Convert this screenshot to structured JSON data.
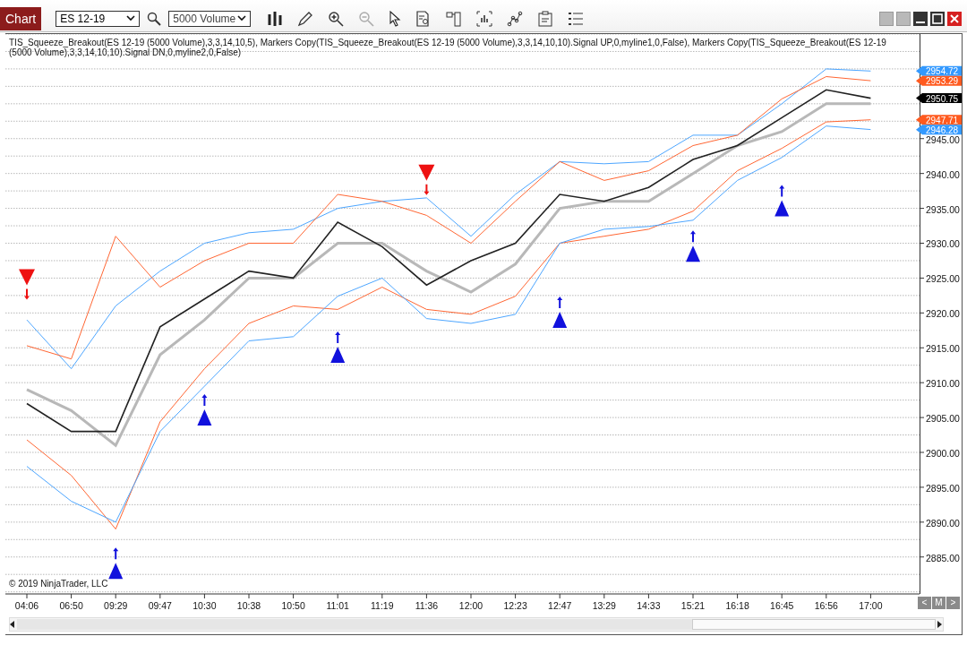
{
  "tab": "Chart",
  "instrument": {
    "value": "ES 12-19"
  },
  "interval": {
    "value": "5000 Volume"
  },
  "legend": "TIS_Squeeze_Breakout(ES 12-19 (5000 Volume),3,3,14,10,5), Markers Copy(TIS_Squeeze_Breakout(ES 12-19 (5000 Volume),3,3,14,10,10).Signal UP,0,myline1,0,False), Markers Copy(TIS_Squeeze_Breakout(ES 12-19 (5000 Volume),3,3,14,10,10).Signal DN,0,myline2,0,False)",
  "copyright": "© 2019 NinjaTrader, LLC",
  "nav_buttons": [
    "<",
    "M",
    ">"
  ],
  "price_tags": [
    {
      "label": "2954.72",
      "color": "#3399ff"
    },
    {
      "label": "2953.29",
      "color": "#ff5a1f"
    },
    {
      "label": "2950.75",
      "color": "#000000"
    },
    {
      "label": "2947.71",
      "color": "#ff5a1f"
    },
    {
      "label": "2946.28",
      "color": "#3399ff"
    }
  ],
  "chart_data": {
    "type": "line",
    "grid": true,
    "categories": [
      "04:06",
      "06:50",
      "09:29",
      "09:47",
      "10:30",
      "10:38",
      "10:50",
      "11:01",
      "11:19",
      "11:36",
      "12:00",
      "12:23",
      "12:47",
      "13:29",
      "14:33",
      "15:21",
      "16:18",
      "16:45",
      "16:56",
      "17:00"
    ],
    "series": [
      {
        "color": "#4da6ff",
        "values": [
          2919,
          2912,
          2921,
          2926,
          2930,
          2931.5,
          2932,
          2935,
          2936,
          2936.5,
          2931,
          2937,
          2941.7,
          2941.4,
          2941.7,
          2945.5,
          2945.5,
          2950,
          2955,
          2954.7
        ]
      },
      {
        "color": "#ff6633",
        "values": [
          2915.3,
          2913.4,
          2931,
          2923.7,
          2927.5,
          2930,
          2930,
          2937,
          2936,
          2934,
          2930,
          2936,
          2941.7,
          2939,
          2940.4,
          2944,
          2945.5,
          2950.7,
          2953.9,
          2953.3
        ]
      },
      {
        "color": "#ff6633",
        "values": [
          2901.8,
          2896.7,
          2889,
          2904.4,
          2912,
          2918.5,
          2921,
          2920.5,
          2923.7,
          2920.5,
          2919.8,
          2922.4,
          2930,
          2931,
          2932,
          2934.6,
          2940.4,
          2943.6,
          2947.4,
          2947.7
        ]
      },
      {
        "color": "#4da6ff",
        "values": [
          2898,
          2893,
          2890,
          2903,
          2909.5,
          2916,
          2916.6,
          2922.4,
          2925,
          2919.2,
          2918.5,
          2919.8,
          2930,
          2932,
          2932.4,
          2933.3,
          2939,
          2942.3,
          2946.8,
          2946.3
        ]
      },
      {
        "color": "#b8b8b8",
        "values": [
          2909,
          2906,
          2901,
          2914,
          2919,
          2925,
          2925,
          2930,
          2930,
          2926,
          2923,
          2927,
          2935,
          2936,
          2936,
          2940,
          2944,
          2946,
          2950,
          2950
        ]
      },
      {
        "color": "#222222",
        "values": [
          2907,
          2903,
          2903,
          2918,
          2922,
          2926,
          2925,
          2933,
          2929.5,
          2924,
          2927.5,
          2930,
          2937,
          2936,
          2938,
          2942,
          2944,
          2948,
          2952,
          2950.8
        ]
      },
      {
        "type": "scatter",
        "color": "#1111dd",
        "values": [
          null,
          null,
          2883,
          null,
          2905,
          null,
          null,
          2914,
          null,
          null,
          null,
          null,
          2919,
          null,
          null,
          2928.5,
          null,
          2935,
          null,
          null
        ]
      },
      {
        "type": "scatter",
        "color": "#ee1111",
        "values": [
          2925,
          null,
          null,
          null,
          null,
          null,
          null,
          null,
          null,
          2940,
          null,
          null,
          null,
          null,
          null,
          null,
          null,
          null,
          null,
          null
        ]
      }
    ],
    "ylim": [
      2879.7,
      2960
    ],
    "yticks": [
      {
        "value": 2885,
        "label": "2885.00"
      },
      {
        "value": 2890,
        "label": "2890.00"
      },
      {
        "value": 2895,
        "label": "2895.00"
      },
      {
        "value": 2900,
        "label": "2900.00"
      },
      {
        "value": 2905,
        "label": "2905.00"
      },
      {
        "value": 2910,
        "label": "2910.00"
      },
      {
        "value": 2915,
        "label": "2915.00"
      },
      {
        "value": 2920,
        "label": "2920.00"
      },
      {
        "value": 2925,
        "label": "2925.00"
      },
      {
        "value": 2930,
        "label": "2930.00"
      },
      {
        "value": 2935,
        "label": "2935.00"
      },
      {
        "value": 2940,
        "label": "2940.00"
      },
      {
        "value": 2945,
        "label": "2945.00"
      }
    ]
  }
}
